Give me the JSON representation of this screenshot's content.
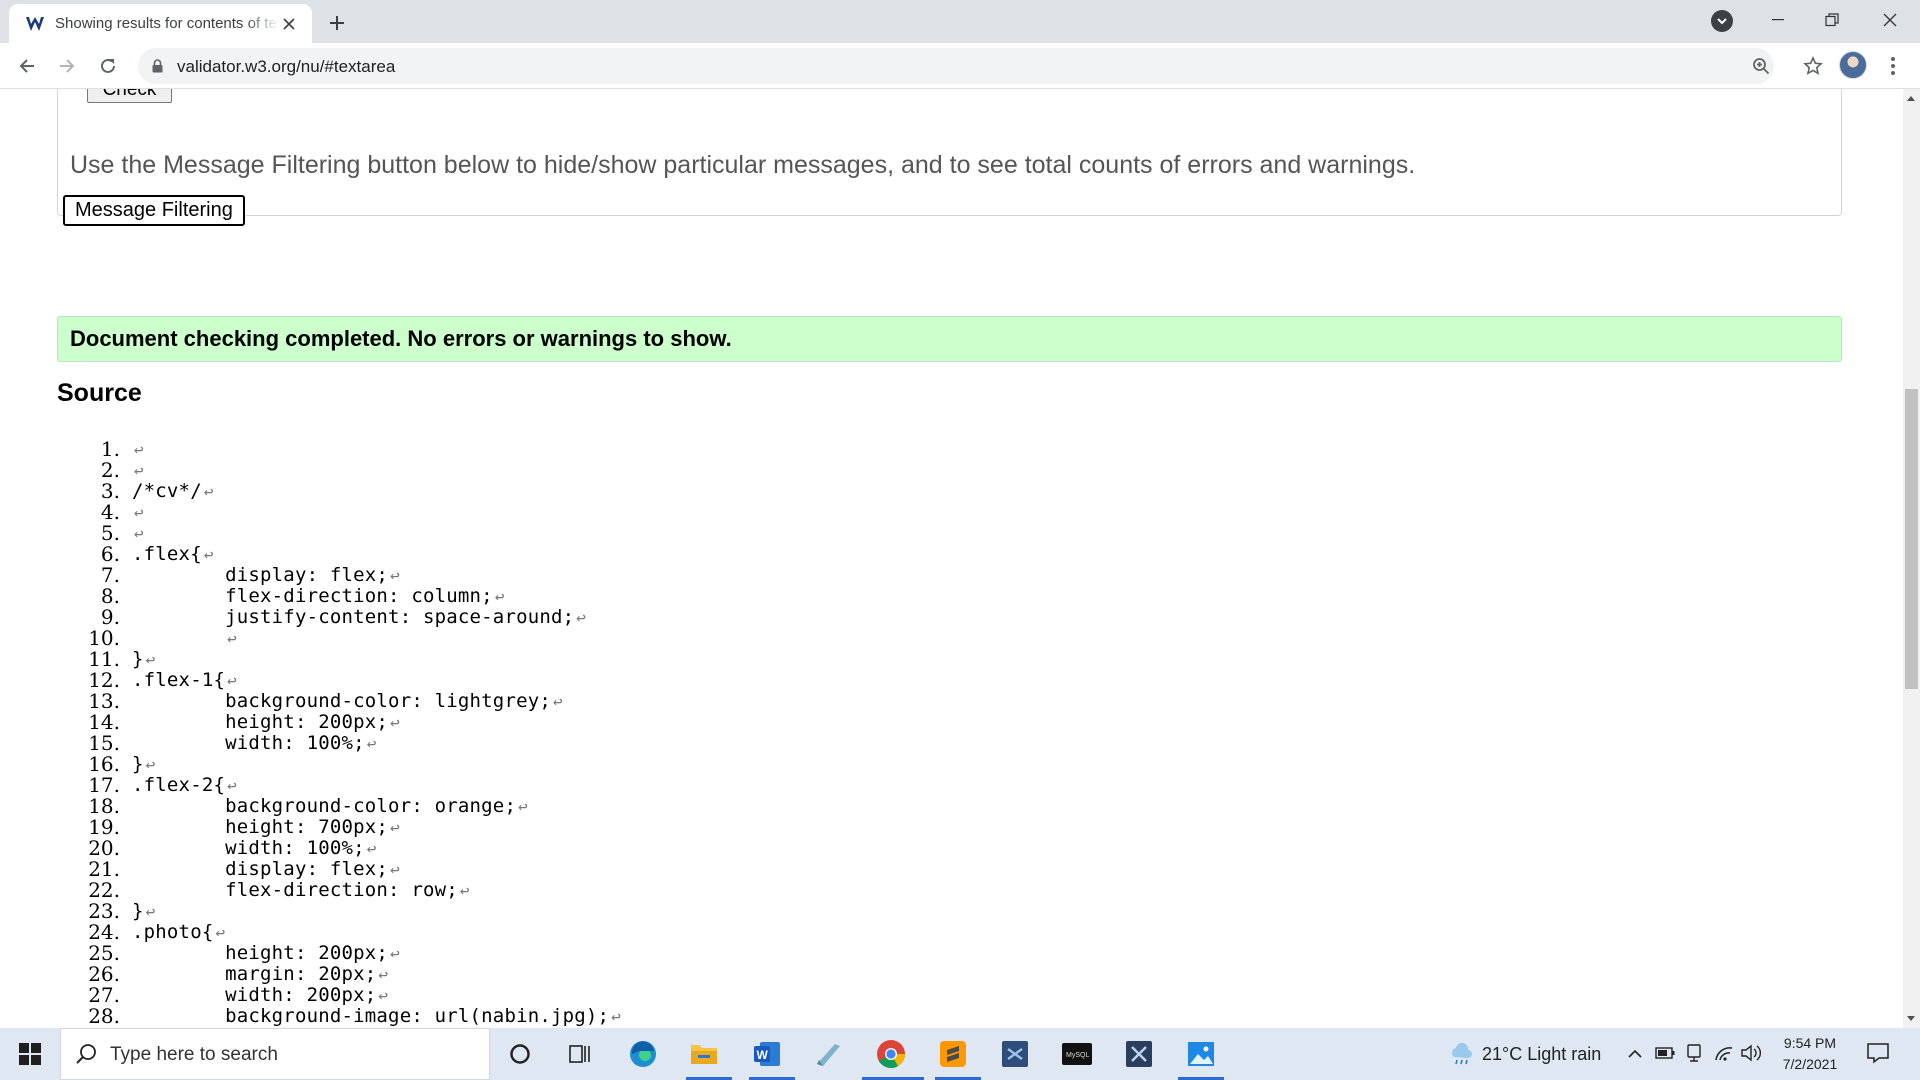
{
  "browser": {
    "tab_title": "Showing results for contents of text-input area",
    "url": "validator.w3.org/nu/#textarea"
  },
  "page": {
    "check_button": "Check",
    "filter_note": "Use the Message Filtering button below to hide/show particular messages, and to see total counts of errors and warnings.",
    "filter_button": "Message Filtering",
    "success_message": "Document checking completed. No errors or warnings to show.",
    "source_heading": "Source",
    "return_glyph": "↩",
    "source_lines": [
      {
        "n": "1.",
        "code": ""
      },
      {
        "n": "2.",
        "code": ""
      },
      {
        "n": "3.",
        "code": "/*cv*/"
      },
      {
        "n": "4.",
        "code": ""
      },
      {
        "n": "5.",
        "code": ""
      },
      {
        "n": "6.",
        "code": ".flex{"
      },
      {
        "n": "7.",
        "code": "        display: flex;"
      },
      {
        "n": "8.",
        "code": "        flex-direction: column;"
      },
      {
        "n": "9.",
        "code": "        justify-content: space-around;"
      },
      {
        "n": "10.",
        "code": "        "
      },
      {
        "n": "11.",
        "code": "}"
      },
      {
        "n": "12.",
        "code": ".flex-1{"
      },
      {
        "n": "13.",
        "code": "        background-color: lightgrey;"
      },
      {
        "n": "14.",
        "code": "        height: 200px;"
      },
      {
        "n": "15.",
        "code": "        width: 100%;"
      },
      {
        "n": "16.",
        "code": "}"
      },
      {
        "n": "17.",
        "code": ".flex-2{"
      },
      {
        "n": "18.",
        "code": "        background-color: orange;"
      },
      {
        "n": "19.",
        "code": "        height: 700px;"
      },
      {
        "n": "20.",
        "code": "        width: 100%;"
      },
      {
        "n": "21.",
        "code": "        display: flex;"
      },
      {
        "n": "22.",
        "code": "        flex-direction: row;"
      },
      {
        "n": "23.",
        "code": "}"
      },
      {
        "n": "24.",
        "code": ".photo{"
      },
      {
        "n": "25.",
        "code": "        height: 200px;"
      },
      {
        "n": "26.",
        "code": "        margin: 20px;"
      },
      {
        "n": "27.",
        "code": "        width: 200px;"
      },
      {
        "n": "28.",
        "code": "        background-image: url(nabin.jpg);"
      }
    ]
  },
  "taskbar": {
    "search_placeholder": "Type here to search",
    "weather": "21°C  Light rain",
    "time": "9:54 PM",
    "date": "7/2/2021",
    "apps": [
      "cortana-icon",
      "task-view-icon",
      "edge-icon",
      "file-explorer-icon",
      "word-icon",
      "app-icon",
      "chrome-icon",
      "sublime-text-icon",
      "vscode-icon",
      "mysql-icon",
      "visual-studio-icon",
      "photos-icon"
    ]
  },
  "colors": {
    "success_bg": "#ccffcc",
    "tabstrip_bg": "#dee1e6",
    "taskbar_bg": "#dfe7f2",
    "accent": "#2b6cd4"
  }
}
